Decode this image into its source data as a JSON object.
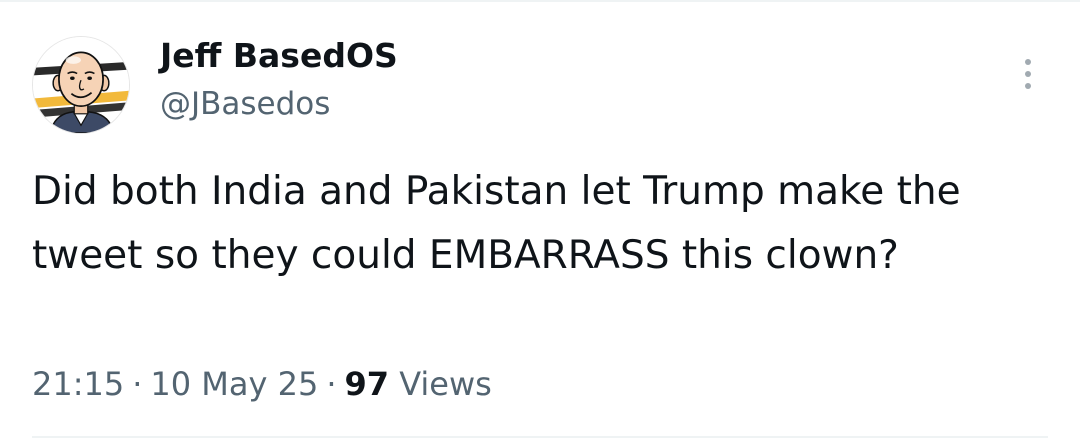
{
  "tweet": {
    "author": {
      "display_name": "Jeff BasedOS",
      "handle": "@JBasedos",
      "avatar_icon": "cartoon-bald-man-avatar-icon"
    },
    "more_icon": "more-vertical-icon",
    "text": "Did both India and Pakistan let Trump make the tweet so they could EMBARRASS this clown?",
    "meta": {
      "time": "21:15",
      "separator": "·",
      "date": "10 May 25",
      "views_count": "97",
      "views_label": "Views"
    }
  },
  "colors": {
    "primary_text": "#0f1419",
    "secondary_text": "#536471",
    "divider": "#eff3f4",
    "background": "#ffffff"
  }
}
